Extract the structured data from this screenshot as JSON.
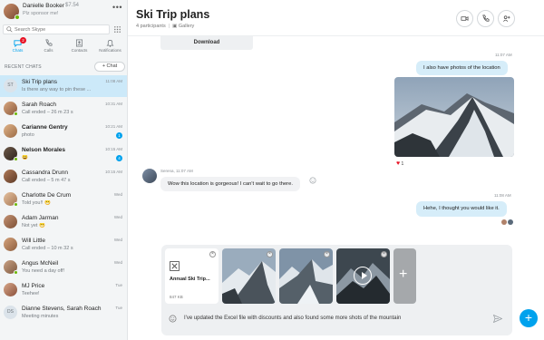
{
  "profile": {
    "name": "Danielle Booker",
    "credit": "$7.54",
    "status": "Plz sponsor me!"
  },
  "search": {
    "placeholder": "Search Skype"
  },
  "nav": [
    {
      "label": "Chats",
      "badge": "2",
      "icon": "chat-icon"
    },
    {
      "label": "Calls",
      "icon": "phone-icon"
    },
    {
      "label": "Contacts",
      "icon": "contacts-icon"
    },
    {
      "label": "Notifications",
      "icon": "bell-icon"
    }
  ],
  "recent": {
    "label": "RECENT CHATS",
    "new_chat": "+ Chat"
  },
  "chats": [
    {
      "name": "Ski Trip plans",
      "initials": "ST",
      "preview": "Is there any way to pin these ...",
      "time": "11:08 AM",
      "selected": true
    },
    {
      "name": "Sarah Roach",
      "preview": "Call ended – 26 m 23 s",
      "time": "10:31 AM"
    },
    {
      "name": "Carianne Gentry",
      "preview": "photo",
      "time": "10:21 AM",
      "badge": "1",
      "bold": true
    },
    {
      "name": "Nelson Morales",
      "preview": "😀",
      "time": "10:15 AM",
      "badge": "4",
      "bold": true
    },
    {
      "name": "Cassandra Drunn",
      "preview": "Call ended – 5 m 47 s",
      "time": "10:15 AM"
    },
    {
      "name": "Charlotte De Crum",
      "preview": "Told you!! 😁",
      "time": "Wed"
    },
    {
      "name": "Adam Jarman",
      "preview": "Not yet 😁",
      "time": "Wed"
    },
    {
      "name": "Will Little",
      "preview": "Call ended – 10 m 32 s",
      "time": "Wed"
    },
    {
      "name": "Angus McNeil",
      "preview": "You need a day off!",
      "time": "Wed"
    },
    {
      "name": "MJ Price",
      "preview": "Teehee!",
      "time": "Tue"
    },
    {
      "name": "Dianne Stevens, Sarah Roach",
      "initials": "DS",
      "preview": "Meeting minutes",
      "time": "Tue"
    }
  ],
  "conversation": {
    "title": "Ski Trip plans",
    "participants": "4 participants",
    "gallery": "Gallery",
    "download_label": "Download",
    "messages": [
      {
        "time": "11:07 AM",
        "text": "I also have photos of the location"
      },
      {
        "reaction_count": "1"
      },
      {
        "sender_meta": "Serena, 11:07 AM",
        "text": "Wow this location is gorgeous! I can't wait to go there."
      },
      {
        "time": "11:08 AM",
        "text": "Hehe, I thought you would like it."
      }
    ]
  },
  "compose": {
    "file_name": "Annual Ski Trip...",
    "file_size": "847 KB",
    "message": "I've updated the Excel file with discounts and also found some more shots of the mountain"
  },
  "colors": {
    "accent": "#00a2ed",
    "bubble_out": "#d6edf9",
    "sidebar_bg": "#f3f5f6"
  }
}
